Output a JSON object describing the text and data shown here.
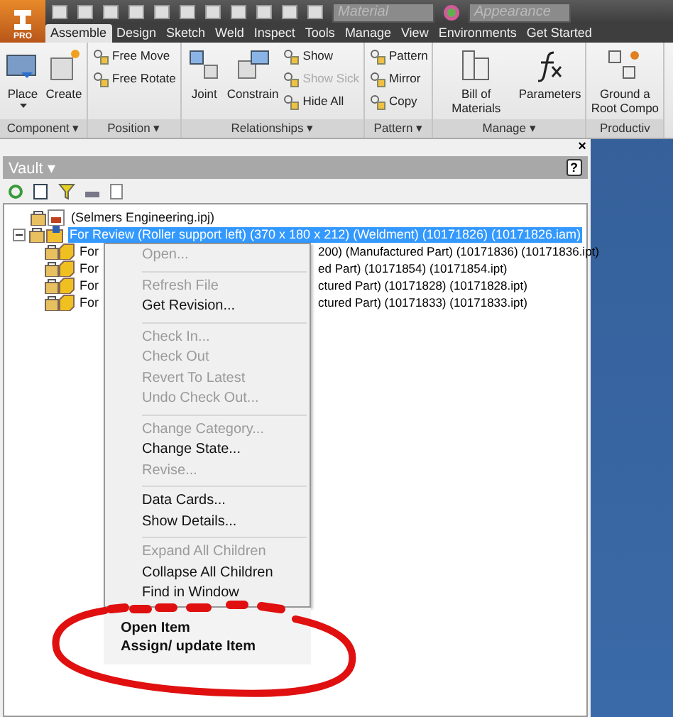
{
  "app_badge": "PRO",
  "quick_access": {
    "material": {
      "placeholder": "Material"
    },
    "appearance": {
      "placeholder": "Appearance"
    }
  },
  "tabs": [
    {
      "label": "Assemble",
      "selected": true
    },
    {
      "label": "Design",
      "selected": false
    },
    {
      "label": "Sketch",
      "selected": false
    },
    {
      "label": "Weld",
      "selected": false
    },
    {
      "label": "Inspect",
      "selected": false
    },
    {
      "label": "Tools",
      "selected": false
    },
    {
      "label": "Manage",
      "selected": false
    },
    {
      "label": "View",
      "selected": false
    },
    {
      "label": "Environments",
      "selected": false
    },
    {
      "label": "Get Started",
      "selected": false
    }
  ],
  "ribbon_panels": [
    {
      "title": "Component ▾",
      "commands": [
        {
          "kind": "large",
          "label": "Place",
          "dropdown": true
        },
        {
          "kind": "large",
          "label": "Create"
        }
      ]
    },
    {
      "title": "Position ▾",
      "commands": [
        {
          "kind": "stack",
          "items": [
            {
              "label": "Free Move",
              "disabled": false
            },
            {
              "label": "Free Rotate",
              "disabled": false
            }
          ]
        }
      ]
    },
    {
      "title": "Relationships ▾",
      "commands": [
        {
          "kind": "large",
          "label": "Joint"
        },
        {
          "kind": "large",
          "label": "Constrain"
        },
        {
          "kind": "stack",
          "items": [
            {
              "label": "Show",
              "disabled": false
            },
            {
              "label": "Show Sick",
              "disabled": true
            },
            {
              "label": "Hide All",
              "disabled": false
            }
          ]
        }
      ]
    },
    {
      "title": "Pattern ▾",
      "commands": [
        {
          "kind": "stack",
          "items": [
            {
              "label": "Pattern",
              "disabled": false
            },
            {
              "label": "Mirror",
              "disabled": false
            },
            {
              "label": "Copy",
              "disabled": false
            }
          ]
        }
      ]
    },
    {
      "title": "Manage ▾",
      "commands": [
        {
          "kind": "large",
          "label": "Bill of Materials"
        },
        {
          "kind": "large",
          "label": "Parameters"
        }
      ]
    },
    {
      "title": "Productiv",
      "commands": [
        {
          "kind": "large",
          "label": "Ground a\nRoot Compo"
        }
      ]
    }
  ],
  "vault": {
    "title": "Vault ▾",
    "close": "×",
    "help": "?",
    "tree": [
      {
        "label": "(Selmers Engineering.ipj)",
        "selected": false
      },
      {
        "label": "For Review (Roller support left) (370 x 180 x 212) (Weldment) (10171826) (10171826.iam)",
        "selected": true,
        "expanded": true,
        "children": [
          {
            "text_left": "For",
            "text_right": "200) (Manufactured Part) (10171836) (10171836.ipt)",
            "selected": false
          },
          {
            "text_left": "For",
            "text_right": "ed Part) (10171854) (10171854.ipt)",
            "selected": false
          },
          {
            "text_left": "For",
            "text_right": "ctured Part) (10171828) (10171828.ipt)",
            "selected": false
          },
          {
            "text_left": "For",
            "text_right": "ctured Part) (10171833) (10171833.ipt)",
            "selected": false
          }
        ]
      }
    ]
  },
  "context_menu": {
    "sections": [
      [
        {
          "label": "Open...",
          "disabled": true
        }
      ],
      [
        {
          "label": "Refresh File",
          "disabled": true
        },
        {
          "label": "Get Revision...",
          "disabled": false
        }
      ],
      [
        {
          "label": "Check In...",
          "disabled": true
        },
        {
          "label": "Check Out",
          "disabled": true
        },
        {
          "label": "Revert To Latest",
          "disabled": true
        },
        {
          "label": "Undo Check Out...",
          "disabled": true
        }
      ],
      [
        {
          "label": "Change Category...",
          "disabled": true
        },
        {
          "label": "Change State...",
          "disabled": false
        },
        {
          "label": "Revise...",
          "disabled": true
        }
      ],
      [
        {
          "label": "Data Cards...",
          "disabled": false
        },
        {
          "label": "Show Details...",
          "disabled": false
        }
      ],
      [
        {
          "label": "Expand All Children",
          "disabled": true
        },
        {
          "label": "Collapse All Children",
          "disabled": false
        },
        {
          "label": "Find in Window",
          "disabled": false
        }
      ]
    ],
    "extra_items": [
      "Open Item",
      "Assign/ update Item"
    ]
  }
}
